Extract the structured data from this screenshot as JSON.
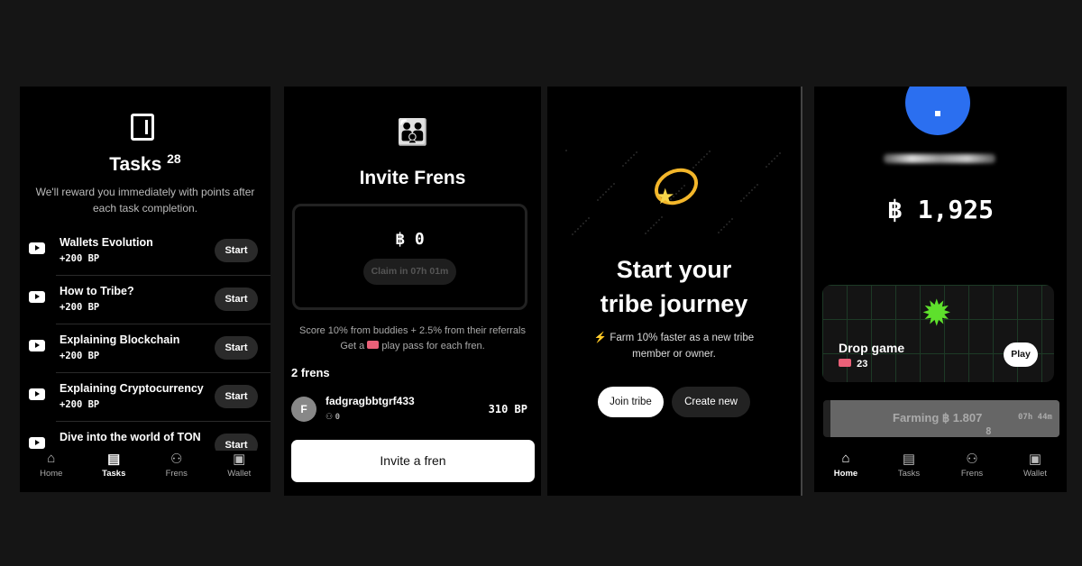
{
  "tasks_screen": {
    "title": "Tasks",
    "count": "28",
    "subtitle": "We'll reward you immediately with points after each task completion.",
    "items": [
      {
        "title": "Wallets Evolution",
        "reward": "+200 BP",
        "button": "Start"
      },
      {
        "title": "How to Tribe?",
        "reward": "+200 BP",
        "button": "Start"
      },
      {
        "title": "Explaining Blockchain",
        "reward": "+200 BP",
        "button": "Start"
      },
      {
        "title": "Explaining Cryptocurrency",
        "reward": "+200 BP",
        "button": "Start"
      },
      {
        "title": "Dive into the world of TON",
        "reward": "",
        "button": "Start"
      }
    ]
  },
  "nav": {
    "home": "Home",
    "tasks": "Tasks",
    "frens": "Frens",
    "wallet": "Wallet"
  },
  "frens_screen": {
    "emoji": "👪",
    "title": "Invite Frens",
    "balance": "฿ 0",
    "claim": "Claim in 07h 01m",
    "info1": "Score 10% from buddies + 2.5% from their referrals",
    "info2a": "Get a",
    "info2b": "play pass for each fren.",
    "count": "2 frens",
    "fren": {
      "initial": "F",
      "name": "fadgragbbtgrf433",
      "refs": "0",
      "points": "310 BP"
    },
    "invite": "Invite a fren"
  },
  "tribe_screen": {
    "title_line1": "Start your",
    "title_line2": "tribe journey",
    "desc_line1": "⚡ Farm 10% faster as a new tribe",
    "desc_line2": "member or owner.",
    "join": "Join tribe",
    "create": "Create new"
  },
  "home_screen": {
    "balance": "฿ 1,925",
    "game_title": "Drop game",
    "passes": "23",
    "play": "Play",
    "farming": "Farming ฿ 1.807",
    "farming_tail": "8",
    "time": "07h 44m",
    "accent": "#2b6ff0"
  }
}
